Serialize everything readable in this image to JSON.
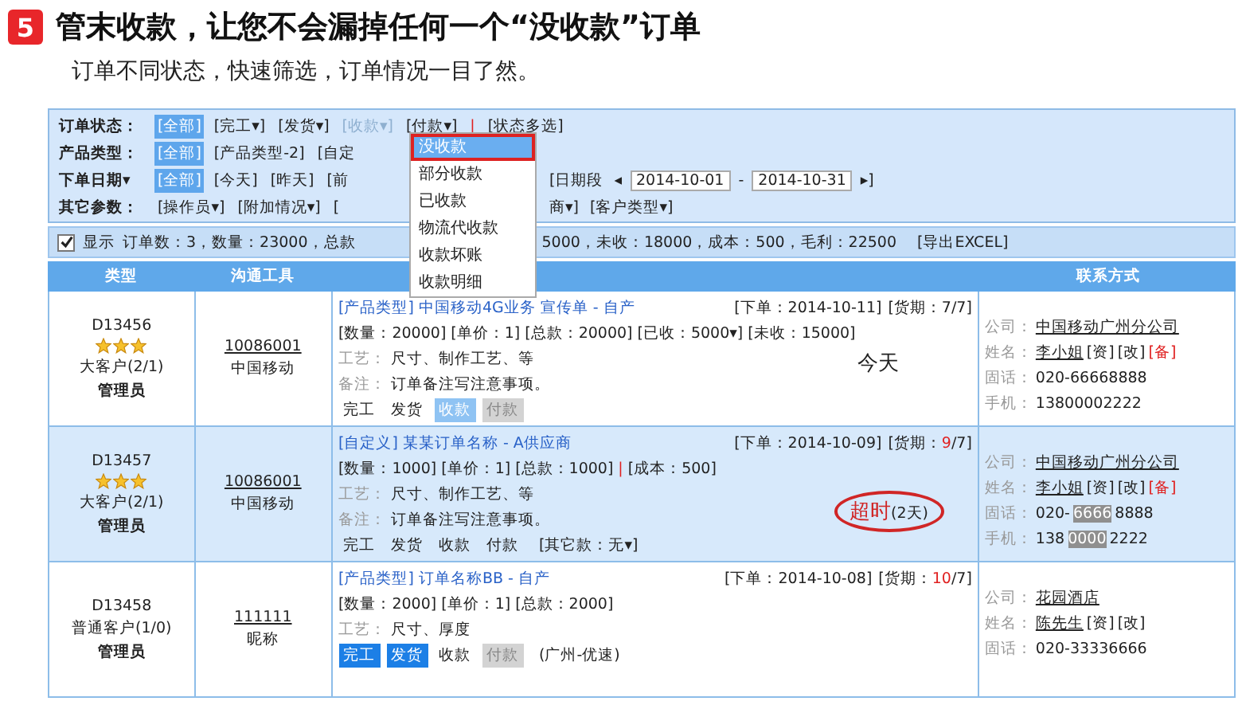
{
  "heading": {
    "badge": "5",
    "title": "管末收款，让您不会漏掉任何一个“没收款”订单",
    "subtitle": "订单不同状态，快速筛选，订单情况一目了然。"
  },
  "filters": [
    {
      "label": "订单状态：",
      "items": [
        {
          "text": "[全部]",
          "selected": true
        },
        {
          "text": "[完工▾]",
          "selected": false
        },
        {
          "text": "[发货▾]",
          "selected": false
        },
        {
          "text": "[收款▾]",
          "selected": false,
          "open": true
        },
        {
          "text": "[付款▾]",
          "selected": false
        },
        {
          "text": "|",
          "kind": "sep",
          "selected": false
        },
        {
          "text": "[状态多选]",
          "selected": false
        }
      ]
    },
    {
      "label": "产品类型：",
      "items": [
        {
          "text": "[全部]",
          "selected": true
        },
        {
          "text": "[产品类型-2]",
          "selected": false
        },
        {
          "text": "[自定",
          "selected": false
        }
      ]
    },
    {
      "label": "下单日期▾",
      "items": [
        {
          "text": "[全部]",
          "selected": true
        },
        {
          "text": "[今天]",
          "selected": false
        },
        {
          "text": "[昨天]",
          "selected": false
        },
        {
          "text": "[前",
          "selected": false
        }
      ],
      "more_items": [
        {
          "text": "[日期段",
          "selected": false
        },
        {
          "text": "◂",
          "kind": "arrow",
          "selected": false
        },
        {
          "text": "2014-10-01",
          "kind": "date",
          "selected": false
        },
        {
          "text": "-",
          "kind": "dash",
          "selected": false
        },
        {
          "text": "2014-10-31",
          "kind": "date",
          "selected": false
        },
        {
          "text": "▸]",
          "kind": "arrow",
          "selected": false
        }
      ]
    },
    {
      "label": "其它参数：",
      "items": [
        {
          "text": "[操作员▾]",
          "selected": false
        },
        {
          "text": "[附加情况▾]",
          "selected": false
        },
        {
          "text": "[",
          "selected": false
        }
      ],
      "more_items": [
        {
          "text": "商▾]",
          "selected": false
        },
        {
          "text": "[客户类型▾]",
          "selected": false
        }
      ]
    }
  ],
  "menu": {
    "items": [
      {
        "text": "没收款",
        "selected": true
      },
      {
        "text": "部分收款",
        "selected": false
      },
      {
        "text": "已收款",
        "selected": false
      },
      {
        "text": "物流代收款",
        "selected": false
      },
      {
        "text": "收款坏账",
        "selected": false
      },
      {
        "text": "收款明细",
        "selected": false
      }
    ]
  },
  "summary": {
    "checked": true,
    "label": "显示",
    "text_before": "订单数：3，数量：23000，总款",
    "text_after": "5000，未收：18000，成本：500，毛利：22500",
    "export": "[导出EXCEL]"
  },
  "table": {
    "columns": [
      "类型",
      "沟通工具",
      "",
      "联系方式"
    ],
    "rows": [
      {
        "highlighted": false,
        "code": "D13456",
        "stars": 3,
        "customer": "大客户(2/1)",
        "manager": "管理员",
        "contact_no": "10086001",
        "contact_name": "中国移动",
        "title": "[产品类型] 中国移动4G业务 宣传单 - 自产",
        "order_date": "[下单：2014-10-11]",
        "deadline_label": "[货期：",
        "deadline_days": "7",
        "deadline_rest": "/7]",
        "late": false,
        "amounts": [
          {
            "kind": "field",
            "text": "[数量：20000]"
          },
          {
            "kind": "field",
            "text": "[单价：1]"
          },
          {
            "kind": "field",
            "text": "[总款：20000]"
          },
          {
            "kind": "field",
            "text": "[已收：5000▾]"
          },
          {
            "kind": "field",
            "text": "[未收：15000]"
          }
        ],
        "craft_label": "工艺：",
        "craft": "尺寸、制作工艺、等",
        "note_label": "备注：",
        "note": "订单备注写注意事项。",
        "tags": [
          {
            "text": "完工",
            "kind": "plain"
          },
          {
            "text": "发货",
            "kind": "plain"
          },
          {
            "text": "收款",
            "kind": "active"
          },
          {
            "text": "付款",
            "kind": "muted"
          }
        ],
        "status": {
          "kind": "today",
          "text": "今天"
        },
        "contact": [
          {
            "label": "公司：",
            "parts": [
              {
                "text": "中国移动广州分公司",
                "kind": "link"
              }
            ]
          },
          {
            "label": "姓名：",
            "parts": [
              {
                "text": "李小姐",
                "kind": "link"
              },
              {
                "text": "[资]",
                "kind": "plain"
              },
              {
                "text": "[改]",
                "kind": "plain"
              },
              {
                "text": "[备]",
                "kind": "warn"
              }
            ]
          },
          {
            "label": "固话：",
            "parts": [
              {
                "text": "020-66668888",
                "kind": "plain"
              }
            ]
          },
          {
            "label": "手机：",
            "parts": [
              {
                "text": "13800002222",
                "kind": "plain"
              }
            ]
          }
        ]
      },
      {
        "highlighted": true,
        "code": "D13457",
        "stars": 3,
        "customer": "大客户(2/1)",
        "manager": "管理员",
        "contact_no": "10086001",
        "contact_name": "中国移动",
        "title": "[自定义] 某某订单名称 - A供应商",
        "order_date": "[下单：2014-10-09]",
        "deadline_label": "[货期：",
        "deadline_days": "9",
        "deadline_rest": "/7]",
        "late": true,
        "amounts": [
          {
            "kind": "field",
            "text": "[数量：1000]"
          },
          {
            "kind": "field",
            "text": "[单价：1]"
          },
          {
            "kind": "field",
            "text": "[总款：1000]"
          },
          {
            "kind": "sep",
            "text": "|"
          },
          {
            "kind": "field",
            "text": "[成本：500]"
          }
        ],
        "craft_label": "工艺：",
        "craft": "尺寸、制作工艺、等",
        "note_label": "备注：",
        "note": "订单备注写注意事项。",
        "tags": [
          {
            "text": "完工",
            "kind": "plain"
          },
          {
            "text": "发货",
            "kind": "plain"
          },
          {
            "text": "收款",
            "kind": "plain"
          },
          {
            "text": "付款",
            "kind": "plain"
          }
        ],
        "extra": "[其它款：无▾]",
        "status": {
          "kind": "overdue",
          "text": "超时",
          "detail": "(2天)"
        },
        "contact": [
          {
            "label": "公司：",
            "parts": [
              {
                "text": "中国移动广州分公司",
                "kind": "link"
              }
            ]
          },
          {
            "label": "姓名：",
            "parts": [
              {
                "text": "李小姐",
                "kind": "link"
              },
              {
                "text": "[资]",
                "kind": "plain"
              },
              {
                "text": "[改]",
                "kind": "plain"
              },
              {
                "text": "[备]",
                "kind": "warn"
              }
            ]
          },
          {
            "label": "固话：",
            "parts": [
              {
                "text": "020-",
                "kind": "plain"
              },
              {
                "text": "6666",
                "kind": "marked"
              },
              {
                "text": "8888",
                "kind": "plain"
              }
            ]
          },
          {
            "label": "手机：",
            "parts": [
              {
                "text": "138",
                "kind": "plain"
              },
              {
                "text": "0000",
                "kind": "marked"
              },
              {
                "text": "2222",
                "kind": "plain"
              }
            ]
          }
        ]
      },
      {
        "highlighted": false,
        "code": "D13458",
        "customer": "普通客户(1/0)",
        "manager": "管理员",
        "contact_no": "111111",
        "contact_name": "昵称",
        "title": "[产品类型] 订单名称BB - 自产",
        "order_date": "[下单：2014-10-08]",
        "deadline_label": "[货期：",
        "deadline_days": "10",
        "deadline_rest": "/7]",
        "late": true,
        "amounts": [
          {
            "kind": "field",
            "text": "[数量：2000]"
          },
          {
            "kind": "field",
            "text": "[单价：1]"
          },
          {
            "kind": "field",
            "text": "[总款：2000]"
          }
        ],
        "craft_label": "工艺：",
        "craft": "尺寸、厚度",
        "tags": [
          {
            "text": "完工",
            "kind": "done"
          },
          {
            "text": "发货",
            "kind": "done"
          },
          {
            "text": "收款",
            "kind": "plain"
          },
          {
            "text": "付款",
            "kind": "muted"
          }
        ],
        "extra": "(广州-优速)",
        "status": {
          "kind": "none"
        },
        "contact": [
          {
            "label": "公司：",
            "parts": [
              {
                "text": "花园酒店",
                "kind": "link"
              }
            ]
          },
          {
            "label": "姓名：",
            "parts": [
              {
                "text": "陈先生",
                "kind": "link"
              },
              {
                "text": "[资]",
                "kind": "plain"
              },
              {
                "text": "[改]",
                "kind": "plain"
              }
            ]
          },
          {
            "label": "固话：",
            "parts": [
              {
                "text": "020-33336666",
                "kind": "plain"
              }
            ]
          }
        ]
      }
    ]
  }
}
